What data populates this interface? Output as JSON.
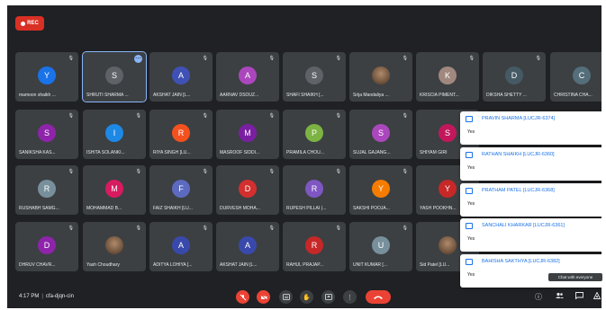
{
  "recording": {
    "label": "REC"
  },
  "colors": {
    "background": "#202124",
    "tile": "#3c4043",
    "accent": "#1a73e8",
    "end_call": "#ea4335"
  },
  "participants": [
    {
      "name": "mamoon shaikh ...",
      "initial": "Y",
      "color": "#1a73e8"
    },
    {
      "name": "SHRUTI SHARMA ...",
      "initial": "S",
      "color": "#5f6368"
    },
    {
      "name": "AKSHAT JAIN [L...",
      "initial": "A",
      "color": "#3f51b5"
    },
    {
      "name": "AARNAV DSOUZ...",
      "initial": "A",
      "color": "#ab47bc"
    },
    {
      "name": "SHAFI SHAIKH [...",
      "initial": "S",
      "color": "#5f6368"
    },
    {
      "name": "Srija Mandaliya ...",
      "initial": "",
      "color": "#6d4c41"
    },
    {
      "name": "KRISCIA PIMENT...",
      "initial": "K",
      "color": "#a1887f"
    },
    {
      "name": "DIKSHA SHETTY ...",
      "initial": "D",
      "color": "#455a64"
    },
    {
      "name": "CHRISTINA CHA...",
      "initial": "C",
      "color": "#546e7a"
    },
    {
      "name": "SANIKSHA KAS...",
      "initial": "S",
      "color": "#8e24aa"
    },
    {
      "name": "ISHITA SOLANKI...",
      "initial": "I",
      "color": "#1e88e5"
    },
    {
      "name": "RIYA SINGH [LU...",
      "initial": "R",
      "color": "#f4511e"
    },
    {
      "name": "MASROOF SIDDI...",
      "initial": "M",
      "color": "#7b1fa2"
    },
    {
      "name": "PRAMILA CHOU...",
      "initial": "P",
      "color": "#7cb342"
    },
    {
      "name": "SUJAL GAJANG...",
      "initial": "S",
      "color": "#ab47bc"
    },
    {
      "name": "SHIYAM GIRI",
      "initial": "S",
      "color": "#c2185b"
    },
    {
      "name": "RUSHABH SAMG...",
      "initial": "R",
      "color": "#78909c"
    },
    {
      "name": "MOHAMMAD B...",
      "initial": "M",
      "color": "#d81b60"
    },
    {
      "name": "FAIZ SHAIKH [LU...",
      "initial": "F",
      "color": "#5c6bc0"
    },
    {
      "name": "DURVESH MOHA...",
      "initial": "D",
      "color": "#d32f2f"
    },
    {
      "name": "RUPESH PILLAI (...",
      "initial": "R",
      "color": "#7e57c2"
    },
    {
      "name": "SAKSHI POOJA...",
      "initial": "Y",
      "color": "#f57c00"
    },
    {
      "name": "YASH POOKHN...",
      "initial": "Y",
      "color": "#c62828"
    },
    {
      "name": "DHRUV CHAVR...",
      "initial": "D",
      "color": "#8e24aa"
    },
    {
      "name": "Yash Choudhary",
      "initial": "",
      "color": "#795548"
    },
    {
      "name": "ADITYA LOHIYA [...",
      "initial": "A",
      "color": "#3949ab"
    },
    {
      "name": "AKSHAT JAIN [L...",
      "initial": "A",
      "color": "#3949ab"
    },
    {
      "name": "RAHUL PRAJAP...",
      "initial": "R",
      "color": "#c62828"
    },
    {
      "name": "UNIT KUMAR [...",
      "initial": "U",
      "color": "#78909c"
    },
    {
      "name": "Sid Patel [LU...",
      "initial": "",
      "color": "#8d6e63"
    }
  ],
  "chat_notifications": [
    {
      "name": "PRAVIN SHARMA [LUCJR-6374]",
      "message": "Yes"
    },
    {
      "name": "RATHAN SHAIKH [LUCJR-6360]",
      "message": "Yes"
    },
    {
      "name": "PRATHAM PATEL [LUCJR-6368]",
      "message": "Yes"
    },
    {
      "name": "SANCHALI KHARKAR [LUCJR-6361]",
      "message": "Yes"
    },
    {
      "name": "BAHISHA SAKTHYA [LUCJR-6382]",
      "message": "Yes"
    }
  ],
  "bottom_bar": {
    "time": "4:17 PM",
    "meeting_code": "cfa-djqn-cin",
    "tooltip": "Chat with everyone"
  },
  "icons": {
    "mic_off": "mic-off-icon",
    "camera_off": "camera-off-icon",
    "captions": "captions-icon",
    "raise_hand": "raise-hand-icon",
    "present": "present-icon",
    "more": "more-options-icon",
    "end_call": "end-call-icon",
    "info": "info-icon",
    "people": "people-icon",
    "chat": "chat-icon",
    "activities": "activities-icon"
  }
}
